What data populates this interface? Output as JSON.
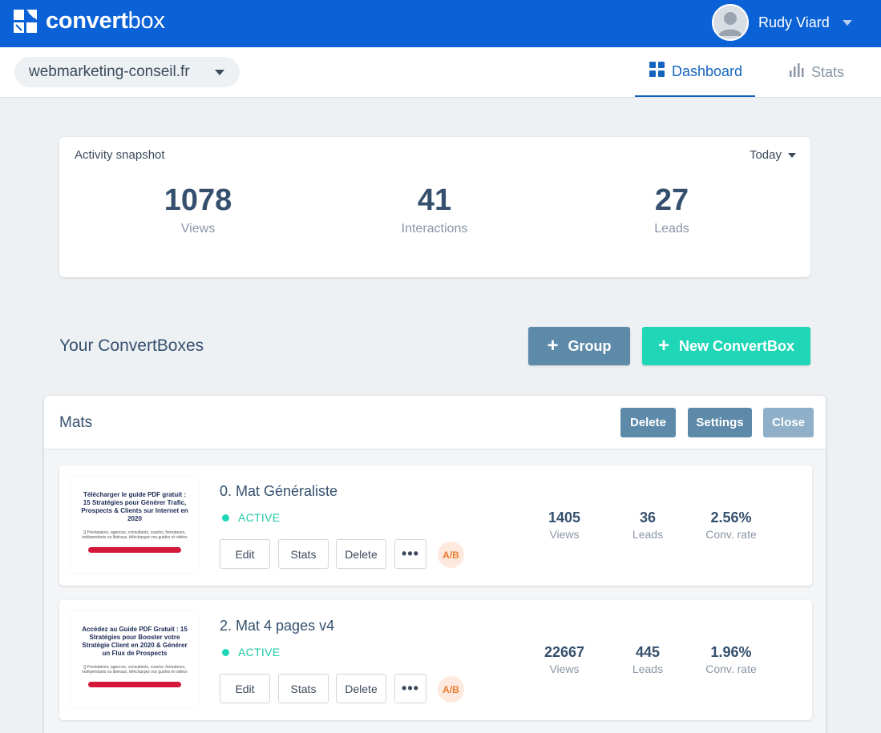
{
  "header": {
    "logo": {
      "bold": "convert",
      "light": "box"
    },
    "user_name": "Rudy Viard"
  },
  "subnav": {
    "site": "webmarketing-conseil.fr",
    "tabs": [
      {
        "label": "Dashboard",
        "icon": "grid-icon",
        "active": true
      },
      {
        "label": "Stats",
        "icon": "bar-chart-icon",
        "active": false
      }
    ]
  },
  "snapshot": {
    "title": "Activity snapshot",
    "period": "Today",
    "stats": [
      {
        "value": "1078",
        "label": "Views"
      },
      {
        "value": "41",
        "label": "Interactions"
      },
      {
        "value": "27",
        "label": "Leads"
      }
    ]
  },
  "section": {
    "title": "Your ConvertBoxes",
    "group_button": "Group",
    "new_button": "New ConvertBox"
  },
  "group": {
    "name": "Mats",
    "delete": "Delete",
    "settings": "Settings",
    "close": "Close"
  },
  "convertboxes": [
    {
      "title": "0. Mat Généraliste",
      "status": "ACTIVE",
      "thumb_headline": "Télécharger le guide PDF gratuit : 15 Stratégies pour Générer Trafic, Prospects & Clients sur Internet en 2020",
      "thumb_body": "[] Prestataires, agences, consultants, coachs, formateurs, indépendants ou libéraux, téléchargez vos guides et vidéos",
      "actions": {
        "edit": "Edit",
        "stats": "Stats",
        "delete": "Delete",
        "more": "•••",
        "ab": "A/B"
      },
      "views": "1405",
      "views_label": "Views",
      "leads": "36",
      "leads_label": "Leads",
      "rate": "2.56%",
      "rate_label": "Conv. rate"
    },
    {
      "title": "2. Mat 4 pages v4",
      "status": "ACTIVE",
      "thumb_headline": "Accédez au Guide PDF Gratuit : 15 Stratégies pour Booster votre Stratégie Client en 2020 & Générer un Flux de Prospects",
      "thumb_body": "[] Prestataires, agences, consultants, coachs, formateurs, indépendants ou libéraux, téléchargez vos guides et vidéos",
      "actions": {
        "edit": "Edit",
        "stats": "Stats",
        "delete": "Delete",
        "more": "•••",
        "ab": "A/B"
      },
      "views": "22667",
      "views_label": "Views",
      "leads": "445",
      "leads_label": "Leads",
      "rate": "1.96%",
      "rate_label": "Conv. rate"
    }
  ],
  "colors": {
    "brand_blue": "#0a62d6",
    "accent_teal": "#1fd6b6",
    "steel_button": "#5e8aaa",
    "ab_orange": "#ea7a2f"
  }
}
